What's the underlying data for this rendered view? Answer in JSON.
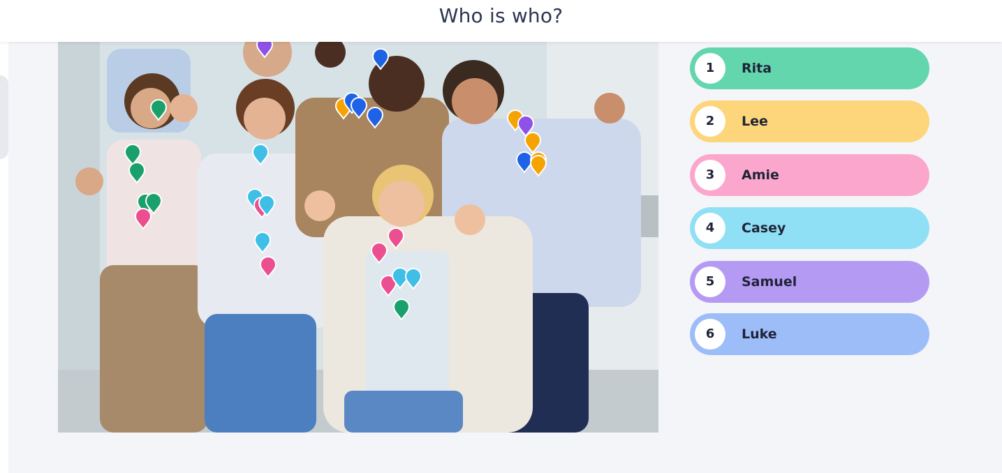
{
  "header": {
    "title": "Who is who?"
  },
  "answers": [
    {
      "number": "1",
      "name": "Rita",
      "color": "#63d6ae"
    },
    {
      "number": "2",
      "name": "Lee",
      "color": "#fdd57a"
    },
    {
      "number": "3",
      "name": "Amie",
      "color": "#fba7cd"
    },
    {
      "number": "4",
      "name": "Casey",
      "color": "#8fe0f5"
    },
    {
      "number": "5",
      "name": "Samuel",
      "color": "#b59af4"
    },
    {
      "number": "6",
      "name": "Luke",
      "color": "#9dbdf9"
    }
  ],
  "pin_colors": {
    "rita": "#1aa06a",
    "lee": "#f5a300",
    "amie": "#ec4f8f",
    "casey": "#3fbfe6",
    "samuel": "#8e52e8",
    "luke": "#1e62e6"
  },
  "photo": {
    "icon": "group-photo"
  }
}
